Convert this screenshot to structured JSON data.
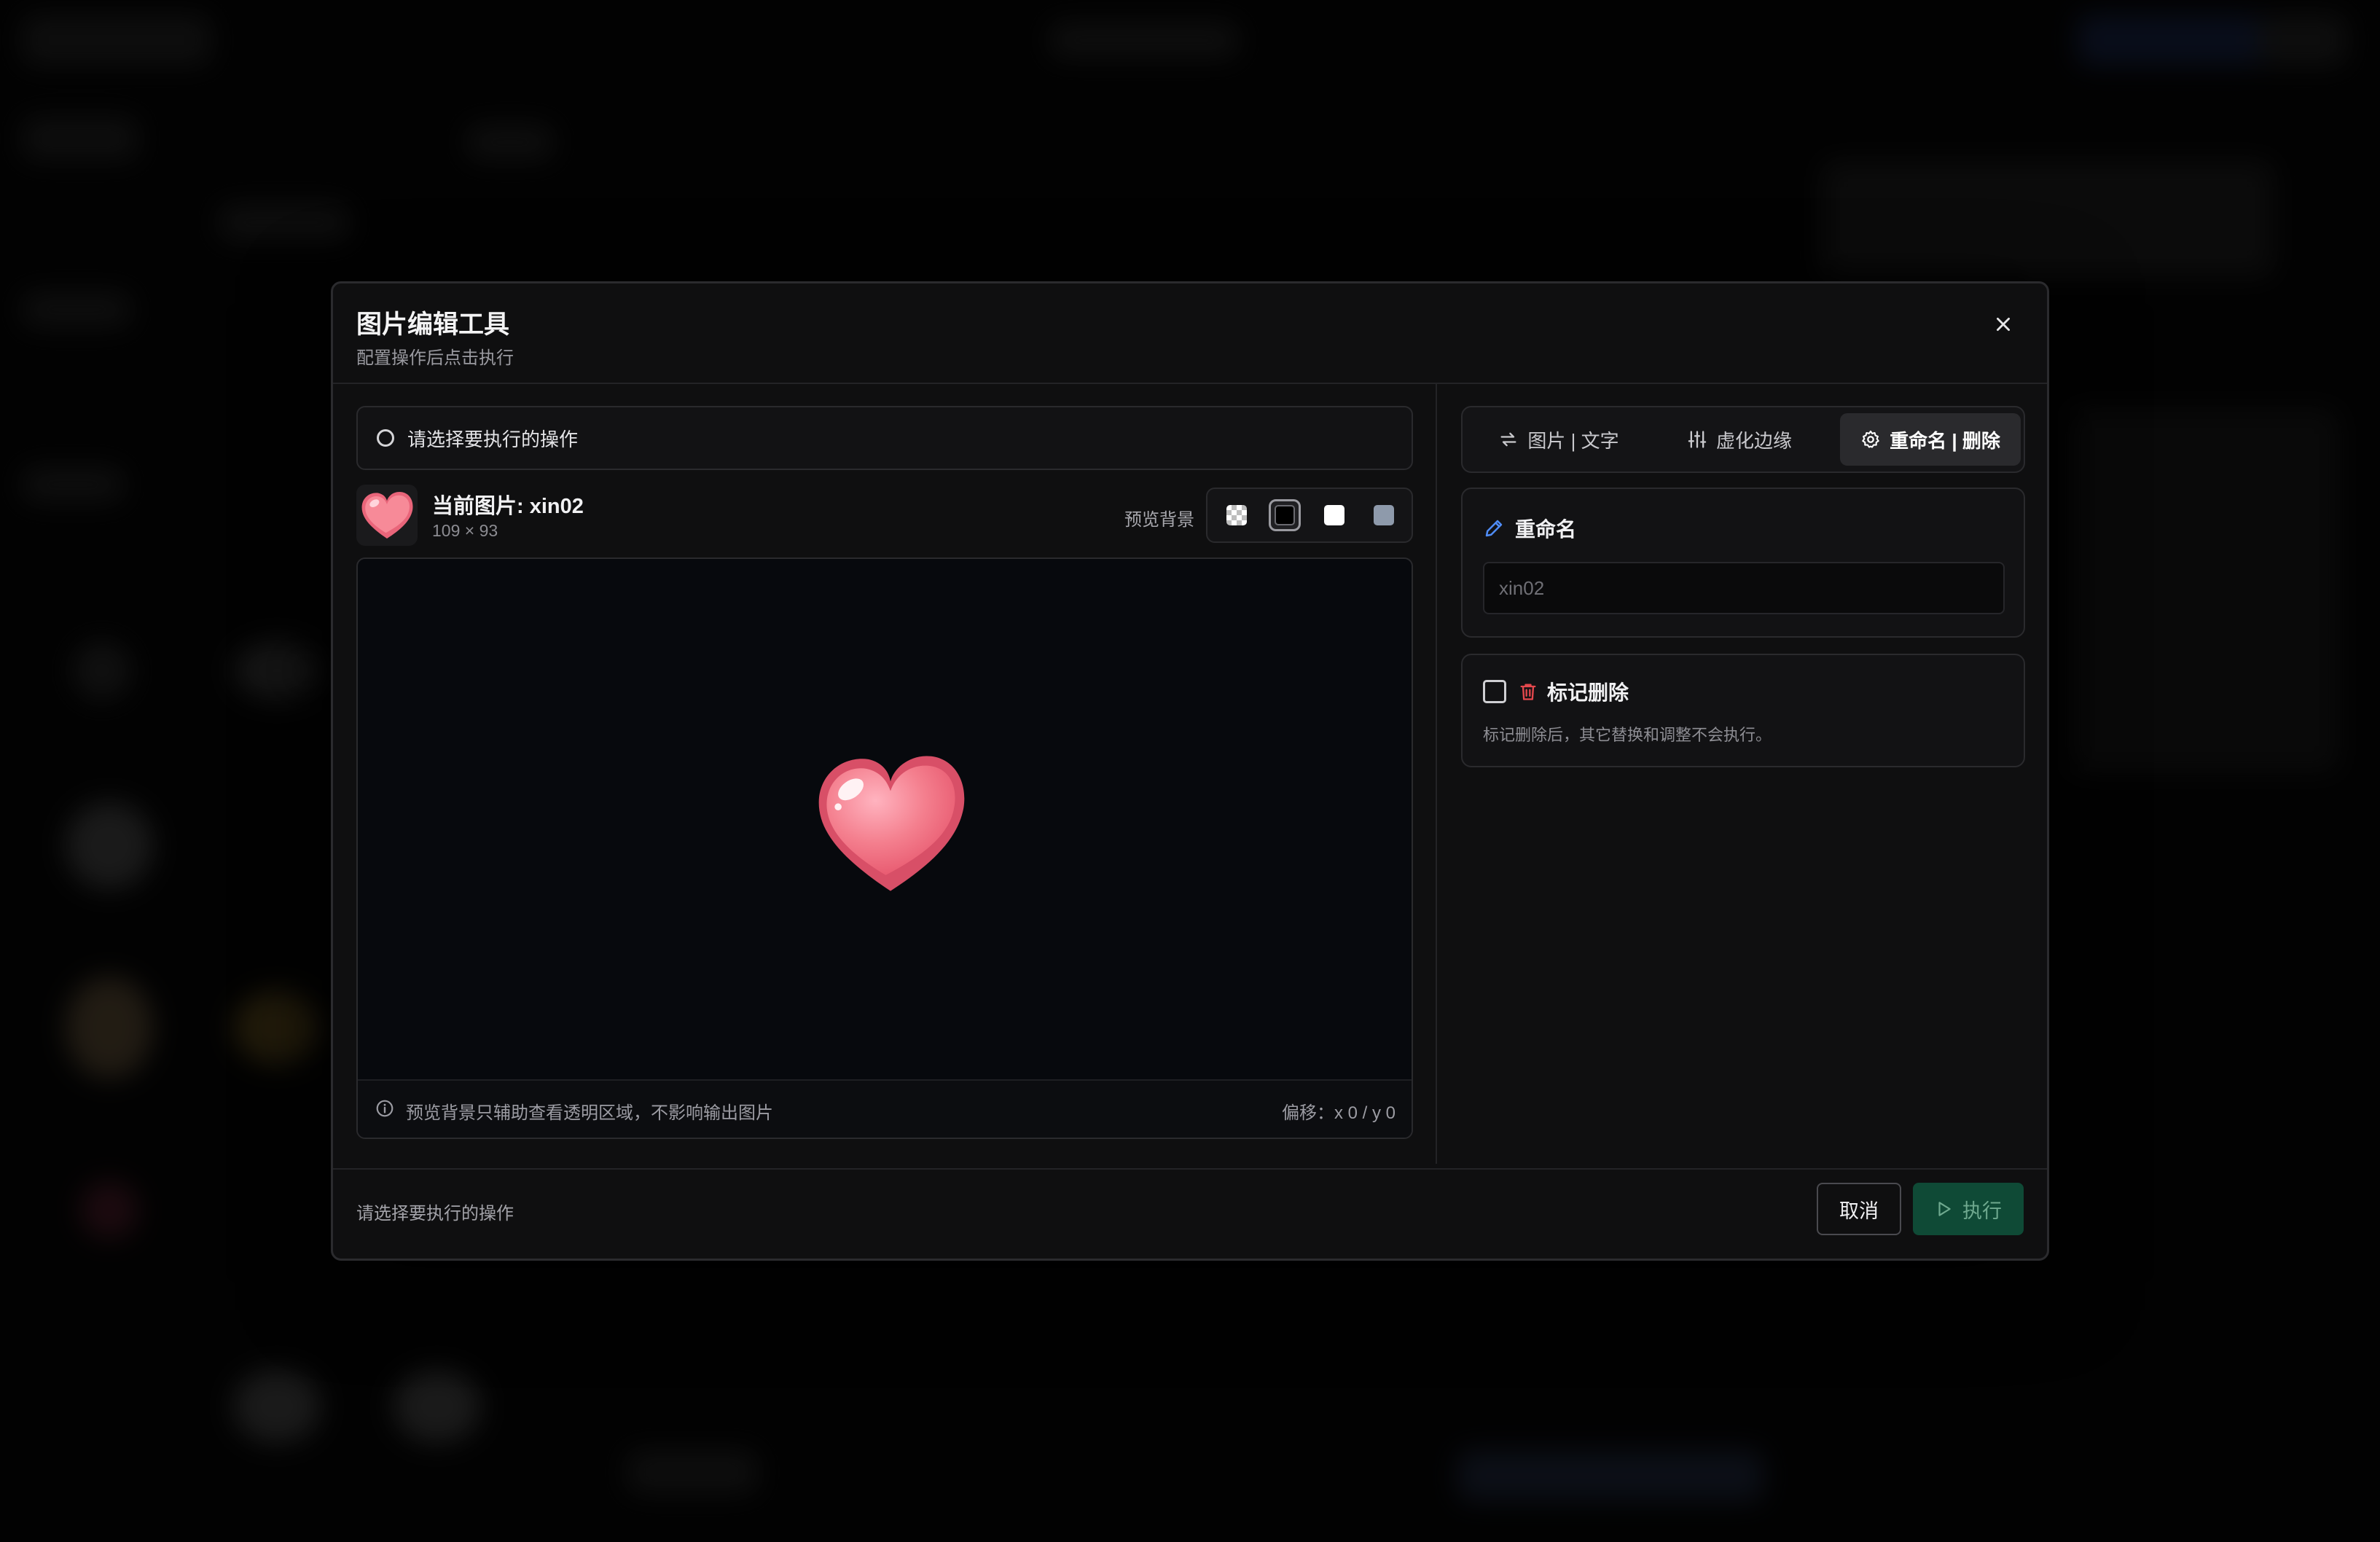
{
  "modal": {
    "title": "图片编辑工具",
    "subtitle": "配置操作后点击执行"
  },
  "operation_select": {
    "placeholder_text": "请选择要执行的操作"
  },
  "current_image": {
    "label": "当前图片: xin02",
    "dimensions": "109 × 93"
  },
  "preview_bg": {
    "label": "预览背景",
    "options": [
      "transparent-checker",
      "black",
      "white",
      "gray"
    ],
    "selected": "black"
  },
  "preview": {
    "note": "预览背景只辅助查看透明区域，不影响输出图片",
    "offset": "偏移：x 0 / y 0"
  },
  "tabs": [
    {
      "label": "图片 | 文字",
      "icon": "swap-icon",
      "active": false
    },
    {
      "label": "虚化边缘",
      "icon": "sliders-icon",
      "active": false
    },
    {
      "label": "重命名 | 删除",
      "icon": "gear-icon",
      "active": true
    }
  ],
  "rename": {
    "heading": "重命名",
    "placeholder": "xin02"
  },
  "delete": {
    "label": "标记删除",
    "description": "标记删除后，其它替换和调整不会执行。",
    "checked": false
  },
  "footer": {
    "status": "请选择要执行的操作",
    "cancel_label": "取消",
    "run_label": "执行"
  },
  "colors": {
    "accent_blue": "#4f8cf7",
    "danger_red": "#e5484d",
    "run_button_bg": "#0f4a36",
    "heart_pink": "#f47f8e"
  }
}
